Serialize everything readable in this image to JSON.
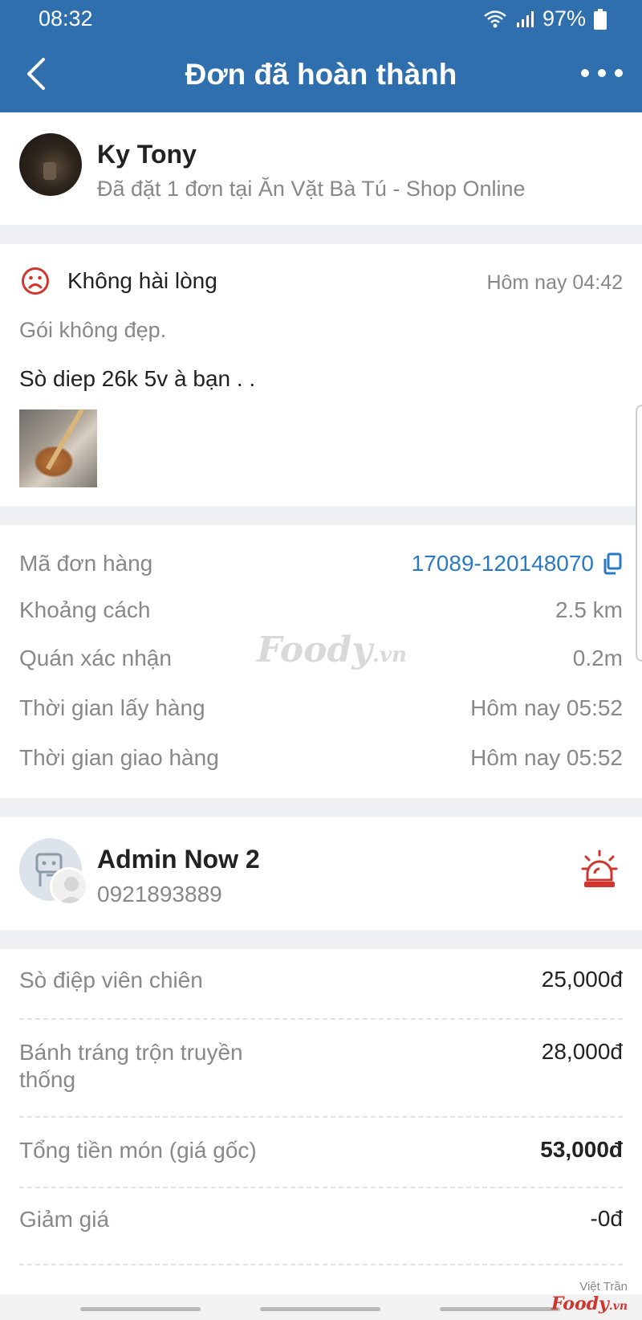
{
  "status_bar": {
    "time": "08:32",
    "battery": "97%"
  },
  "header": {
    "title": "Đơn đã hoàn thành"
  },
  "user": {
    "name": "Ky Tony",
    "subtitle": "Đã đặt 1 đơn tại Ăn Vặt Bà Tú - Shop Online"
  },
  "review": {
    "rating_label": "Không hài lòng",
    "time": "Hôm nay 04:42",
    "tag": "Gói không đẹp.",
    "text": "Sò diep 26k 5v à bạn . ."
  },
  "order": {
    "code_label": "Mã đơn hàng",
    "code_value": "17089-120148070",
    "distance_label": "Khoảng cách",
    "distance_value": "2.5 km",
    "confirm_label": "Quán xác nhận",
    "confirm_value": "0.2m",
    "pickup_label": "Thời gian lấy hàng",
    "pickup_value": "Hôm nay 05:52",
    "delivery_label": "Thời gian giao hàng",
    "delivery_value": "Hôm nay 05:52",
    "watermark": "Foody",
    "watermark_suffix": ".vn"
  },
  "driver": {
    "name": "Admin Now 2",
    "phone": "0921893889"
  },
  "items": [
    {
      "name": "Sò điệp viên chiên",
      "price": "25,000đ"
    },
    {
      "name": "Bánh tráng trộn truyền thống",
      "price": "28,000đ"
    }
  ],
  "summary": {
    "subtotal_label": "Tổng tiền món (giá gốc)",
    "subtotal_value": "53,000đ",
    "discount_label": "Giảm giá",
    "discount_value": "-0đ"
  },
  "corner": {
    "author": "Việt Trần",
    "brand": "Foody",
    "brand_suffix": ".vn"
  },
  "colors": {
    "header": "#2f6fad",
    "link": "#2a7ac2",
    "alert": "#d0362e"
  }
}
